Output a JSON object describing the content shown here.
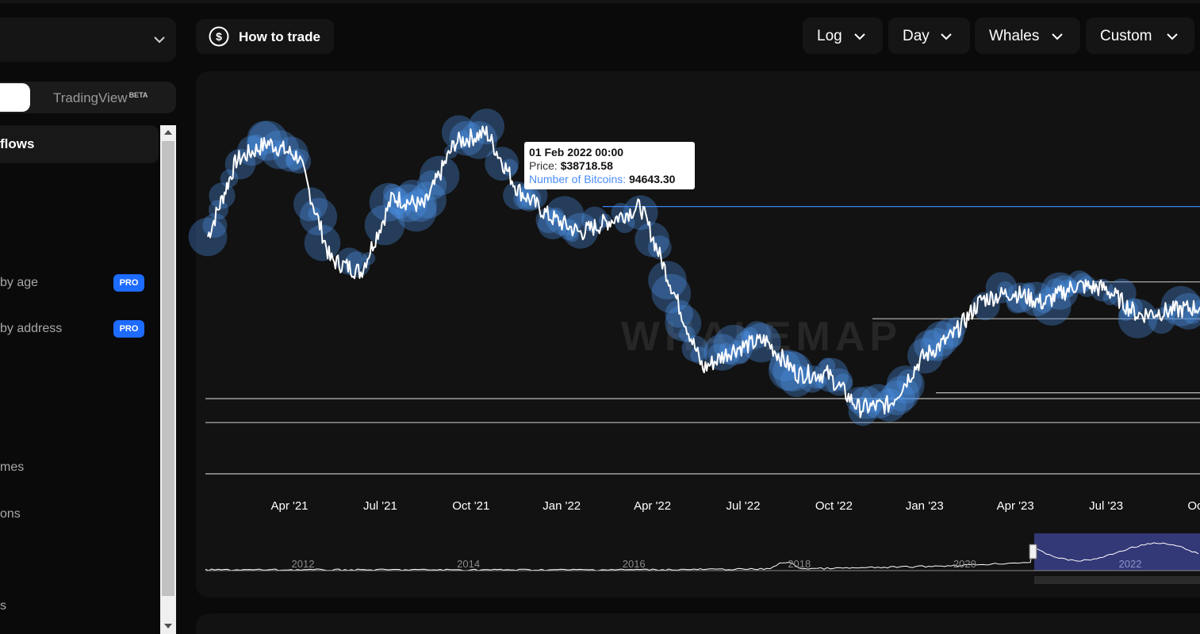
{
  "sidebar": {
    "toggle_option": "TradingView",
    "toggle_badge": "BETA",
    "items": [
      {
        "label": "flows"
      },
      {
        "label": "by age",
        "badge": "PRO"
      },
      {
        "label": "by address",
        "badge": "PRO"
      },
      {
        "label": "mes"
      },
      {
        "label": "ons"
      },
      {
        "label": "s"
      }
    ]
  },
  "header": {
    "how_to_trade": "How to trade",
    "dropdowns": [
      {
        "label": "Log"
      },
      {
        "label": "Day"
      },
      {
        "label": "Whales"
      },
      {
        "label": "Custom"
      }
    ]
  },
  "chart": {
    "watermark": "WHALEMAP",
    "tooltip": {
      "date": "01 Feb 2022 00:00",
      "price_label": "Price:",
      "price_value": "$38718.58",
      "btc_label": "Number of Bitcoins:",
      "btc_value": "94643.30"
    },
    "navigator_years": [
      "2012",
      "2014",
      "2016",
      "2018",
      "2020",
      "2022"
    ],
    "colors": {
      "line": "#ffffff",
      "bubble": "#4a90e2",
      "level": "#3b82f6",
      "navigator": "#3a3f8a"
    }
  },
  "chart_data": {
    "type": "line",
    "x_ticks": [
      "Apr '21",
      "Jul '21",
      "Oct '21",
      "Jan '22",
      "Apr '22",
      "Jul '22",
      "Oct '22",
      "Jan '23",
      "Apr '23",
      "Jul '23",
      "Oct"
    ],
    "yscale": "log",
    "series": [
      {
        "x": [
          "2021-02",
          "2021-03",
          "2021-04",
          "2021-05",
          "2021-06",
          "2021-07",
          "2021-08",
          "2021-09",
          "2021-10",
          "2021-11",
          "2021-12",
          "2022-01",
          "2022-02",
          "2022-03",
          "2022-04",
          "2022-05",
          "2022-06",
          "2022-07",
          "2022-08",
          "2022-09",
          "2022-10",
          "2022-11",
          "2022-12",
          "2023-01",
          "2023-02",
          "2023-03",
          "2023-04",
          "2023-05",
          "2023-06",
          "2023-07",
          "2023-08",
          "2023-09",
          "2023-10"
        ],
        "values": [
          38000,
          55000,
          60000,
          56000,
          34000,
          32000,
          46000,
          44000,
          60000,
          63000,
          48000,
          42000,
          38718.58,
          41000,
          44000,
          30000,
          20000,
          22000,
          23000,
          19500,
          19500,
          16500,
          16800,
          21000,
          23500,
          28000,
          29000,
          27500,
          30000,
          29500,
          26000,
          26500,
          27000
        ]
      }
    ]
  }
}
